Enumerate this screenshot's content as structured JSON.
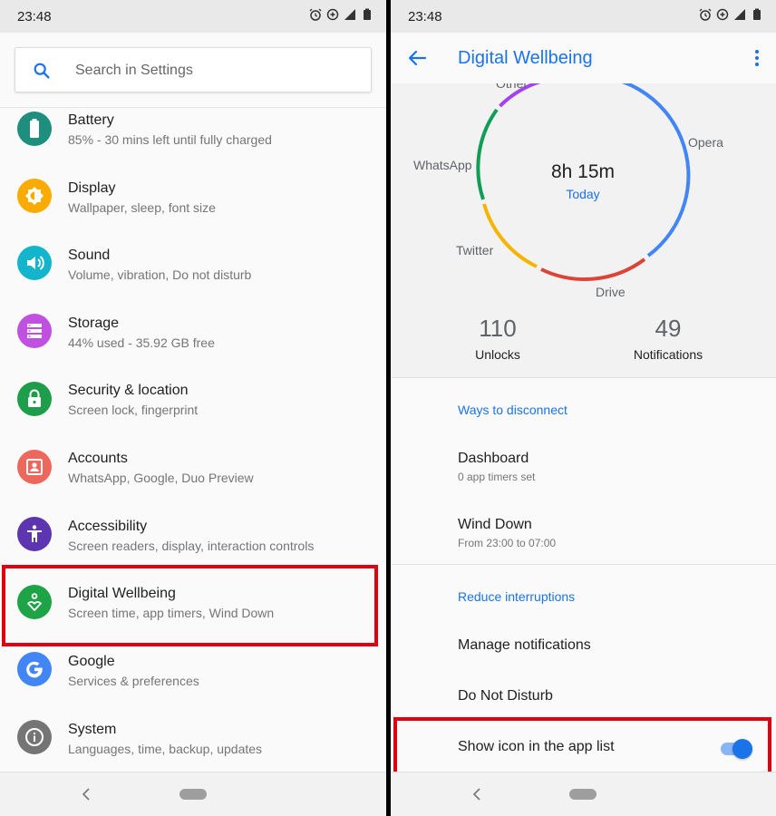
{
  "status_bar": {
    "time": "23:48"
  },
  "settings": {
    "search_placeholder": "Search in Settings",
    "items": [
      {
        "title": "Battery",
        "subtitle": "85% - 30 mins left until fully charged",
        "icon": "battery-icon",
        "color": "#1e8e7e"
      },
      {
        "title": "Display",
        "subtitle": "Wallpaper, sleep, font size",
        "icon": "brightness-icon",
        "color": "#f9ab00"
      },
      {
        "title": "Sound",
        "subtitle": "Volume, vibration, Do not disturb",
        "icon": "volume-icon",
        "color": "#12b5cb"
      },
      {
        "title": "Storage",
        "subtitle": "44% used - 35.92 GB free",
        "icon": "storage-icon",
        "color": "#c051e0"
      },
      {
        "title": "Security & location",
        "subtitle": "Screen lock, fingerprint",
        "icon": "lock-icon",
        "color": "#1e9e4a"
      },
      {
        "title": "Accounts",
        "subtitle": "WhatsApp, Google, Duo Preview",
        "icon": "account-icon",
        "color": "#ee675c"
      },
      {
        "title": "Accessibility",
        "subtitle": "Screen readers, display, interaction controls",
        "icon": "accessibility-icon",
        "color": "#5e35b1"
      },
      {
        "title": "Digital Wellbeing",
        "subtitle": "Screen time, app timers, Wind Down",
        "icon": "wellbeing-icon",
        "color": "#1ea446"
      },
      {
        "title": "Google",
        "subtitle": "Services & preferences",
        "icon": "google-icon",
        "color": "#4285f4"
      },
      {
        "title": "System",
        "subtitle": "Languages, time, backup, updates",
        "icon": "info-icon",
        "color": "#757575"
      }
    ]
  },
  "wellbeing": {
    "title": "Digital Wellbeing",
    "total_time": "8h 15m",
    "period": "Today",
    "apps": [
      {
        "name": "Other",
        "color": "#a142f4"
      },
      {
        "name": "Opera",
        "color": "#4285f4"
      },
      {
        "name": "Drive",
        "color": "#db4437"
      },
      {
        "name": "Twitter",
        "color": "#f4b400"
      },
      {
        "name": "WhatsApp",
        "color": "#0f9d58"
      }
    ],
    "stats": {
      "unlocks_value": "110",
      "unlocks_label": "Unlocks",
      "notifications_value": "49",
      "notifications_label": "Notifications"
    },
    "section_disconnect": "Ways to disconnect",
    "dashboard_title": "Dashboard",
    "dashboard_sub": "0 app timers set",
    "winddown_title": "Wind Down",
    "winddown_sub": "From 23:00 to 07:00",
    "section_interruptions": "Reduce interruptions",
    "manage_notifications": "Manage notifications",
    "do_not_disturb": "Do Not Disturb",
    "show_icon": "Show icon in the app list",
    "show_icon_enabled": true
  }
}
